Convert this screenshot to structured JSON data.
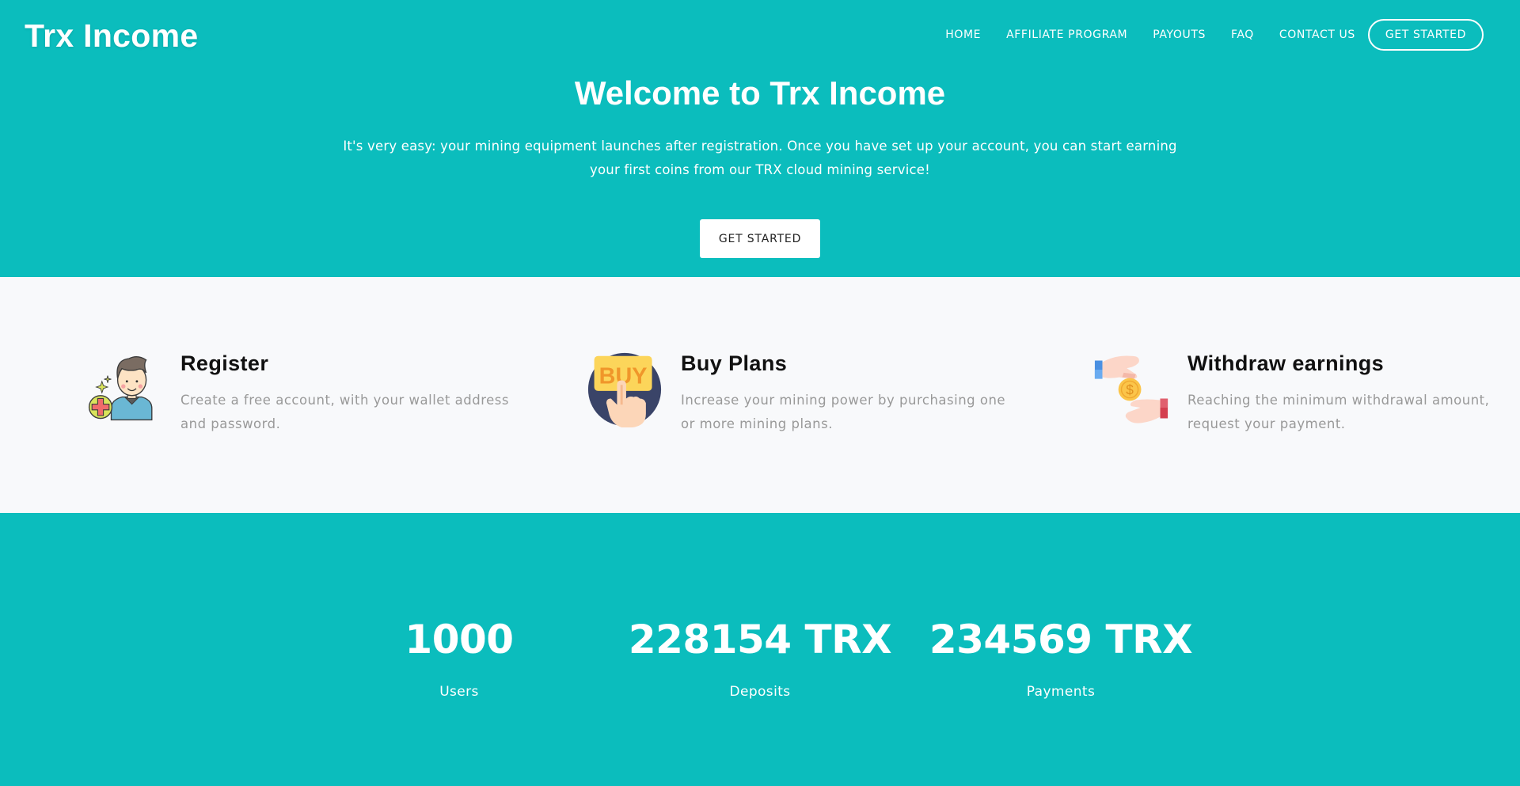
{
  "brand": {
    "name": "Trx Income",
    "primary_color": "#0bbdbd",
    "light_bg": "#f8f9fb"
  },
  "nav": {
    "items": [
      {
        "label": "HOME"
      },
      {
        "label": "AFFILIATE PROGRAM"
      },
      {
        "label": "PAYOUTS"
      },
      {
        "label": "FAQ"
      },
      {
        "label": "CONTACT US"
      }
    ],
    "cta_label": "GET STARTED"
  },
  "hero": {
    "title": "Welcome to Trx Income",
    "text_line1": "It's very easy: your mining equipment launches after registration. Once you have set up your account, you can start earning",
    "text_line2": "your first coins from our TRX cloud mining service!",
    "button_label": "GET STARTED"
  },
  "steps": [
    {
      "icon": "user-add-icon",
      "title": "Register",
      "text": "Create a free account, with your wallet address and password."
    },
    {
      "icon": "buy-icon",
      "title": "Buy Plans",
      "text": "Increase your mining power by purchasing one or more mining plans."
    },
    {
      "icon": "money-transfer-icon",
      "title": "Withdraw earnings",
      "text": "Reaching the minimum withdrawal amount, request your payment."
    }
  ],
  "stats": [
    {
      "value": "1000",
      "label": "Users"
    },
    {
      "value": "228154 TRX",
      "label": "Deposits"
    },
    {
      "value": "234569 TRX",
      "label": "Payments"
    }
  ]
}
